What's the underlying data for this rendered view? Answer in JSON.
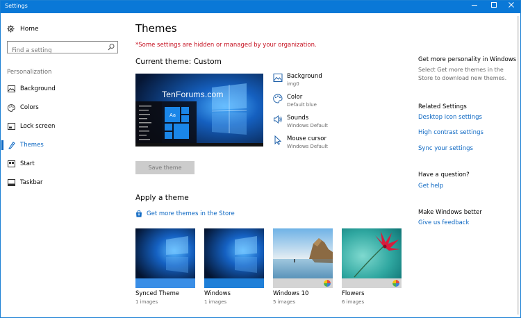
{
  "window": {
    "title": "Settings"
  },
  "sidebar": {
    "home_label": "Home",
    "search_placeholder": "Find a setting",
    "section_label": "Personalization",
    "items": [
      {
        "label": "Background",
        "icon": "image-icon"
      },
      {
        "label": "Colors",
        "icon": "palette-icon"
      },
      {
        "label": "Lock screen",
        "icon": "lock-screen-icon"
      },
      {
        "label": "Themes",
        "icon": "themes-icon",
        "active": true
      },
      {
        "label": "Start",
        "icon": "start-icon"
      },
      {
        "label": "Taskbar",
        "icon": "taskbar-icon"
      }
    ]
  },
  "main": {
    "title": "Themes",
    "warning": "*Some settings are hidden or managed by your organization.",
    "current_theme_label": "Current theme: Custom",
    "preview_watermark": "TenForums.com",
    "preview_tile_label": "Aa",
    "properties": [
      {
        "name": "Background",
        "value": "img0",
        "icon": "image-icon"
      },
      {
        "name": "Color",
        "value": "Default blue",
        "icon": "palette-icon"
      },
      {
        "name": "Sounds",
        "value": "Windows Default",
        "icon": "speaker-icon"
      },
      {
        "name": "Mouse cursor",
        "value": "Windows Default",
        "icon": "cursor-icon"
      }
    ],
    "save_button": "Save theme",
    "apply_title": "Apply a theme",
    "store_link": "Get more themes in the Store",
    "themes": [
      {
        "name": "Synced Theme",
        "count": "1 images"
      },
      {
        "name": "Windows",
        "count": "1 images"
      },
      {
        "name": "Windows 10",
        "count": "5 images"
      },
      {
        "name": "Flowers",
        "count": "6 images"
      }
    ]
  },
  "right_panel": {
    "personality_heading": "Get more personality in Windows",
    "personality_text": "Select Get more themes in the Store to download new themes.",
    "related_heading": "Related Settings",
    "related_links": [
      "Desktop icon settings",
      "High contrast settings",
      "Sync your settings"
    ],
    "question_heading": "Have a question?",
    "help_link": "Get help",
    "better_heading": "Make Windows better",
    "feedback_link": "Give us feedback"
  },
  "colors": {
    "accent": "#0a78d7",
    "link": "#0a66c2",
    "warning": "#c50f1f"
  }
}
